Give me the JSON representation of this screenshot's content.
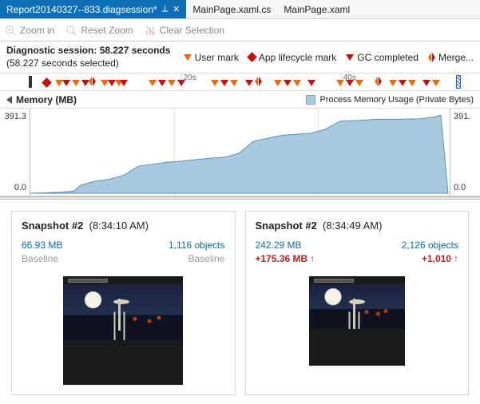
{
  "tabs": {
    "active": "Report20140327--833.diagsession*",
    "t1": "MainPage.xaml.cs",
    "t2": "MainPage.xaml"
  },
  "toolbar": {
    "zoom_in": "Zoom in",
    "reset_zoom": "Reset Zoom",
    "clear_selection": "Clear Selection"
  },
  "session": {
    "line1": "Diagnostic session: 58.227 seconds",
    "line2": "(58.227 seconds selected)"
  },
  "legend": {
    "user_mark": "User mark",
    "app_lifecycle": "App lifecycle mark",
    "gc": "GC completed",
    "merge": "Merge..."
  },
  "timeline": {
    "tick20": "20s",
    "tick40": "40s"
  },
  "memory": {
    "title": "Memory (MB)",
    "legend": "Process Memory Usage (Private Bytes)",
    "ymax": "391.3",
    "ymin": "0.0",
    "ymaxr": "391.",
    "yminr": "0.0"
  },
  "snap1": {
    "title": "Snapshot #2",
    "time": "(8:34:10 AM)",
    "size": "66.93 MB",
    "objects": "1,116 objects",
    "baseline1": "Baseline",
    "baseline2": "Baseline"
  },
  "snap2": {
    "title": "Snapshot #2",
    "time": "(8:34:49 AM)",
    "size": "242.29 MB",
    "objects": "2,126 objects",
    "dsize": "+175.36 MB",
    "dobj": "+1,010"
  },
  "chart_data": {
    "type": "area",
    "title": "Memory (MB)",
    "xlabel": "seconds",
    "ylabel": "MB",
    "ylim": [
      0,
      391.3
    ],
    "xlim": [
      0,
      58.227
    ],
    "x": [
      0,
      2,
      4,
      6,
      7,
      9,
      11,
      13,
      15,
      17,
      19,
      21,
      23,
      25,
      27,
      29,
      31,
      33,
      35,
      37,
      39,
      41,
      43,
      46,
      48,
      51,
      54,
      56,
      57,
      58
    ],
    "values": [
      0,
      2,
      5,
      10,
      40,
      60,
      70,
      90,
      135,
      145,
      155,
      160,
      168,
      175,
      180,
      200,
      260,
      275,
      290,
      295,
      300,
      320,
      360,
      365,
      370,
      370,
      372,
      380,
      391,
      0
    ]
  }
}
